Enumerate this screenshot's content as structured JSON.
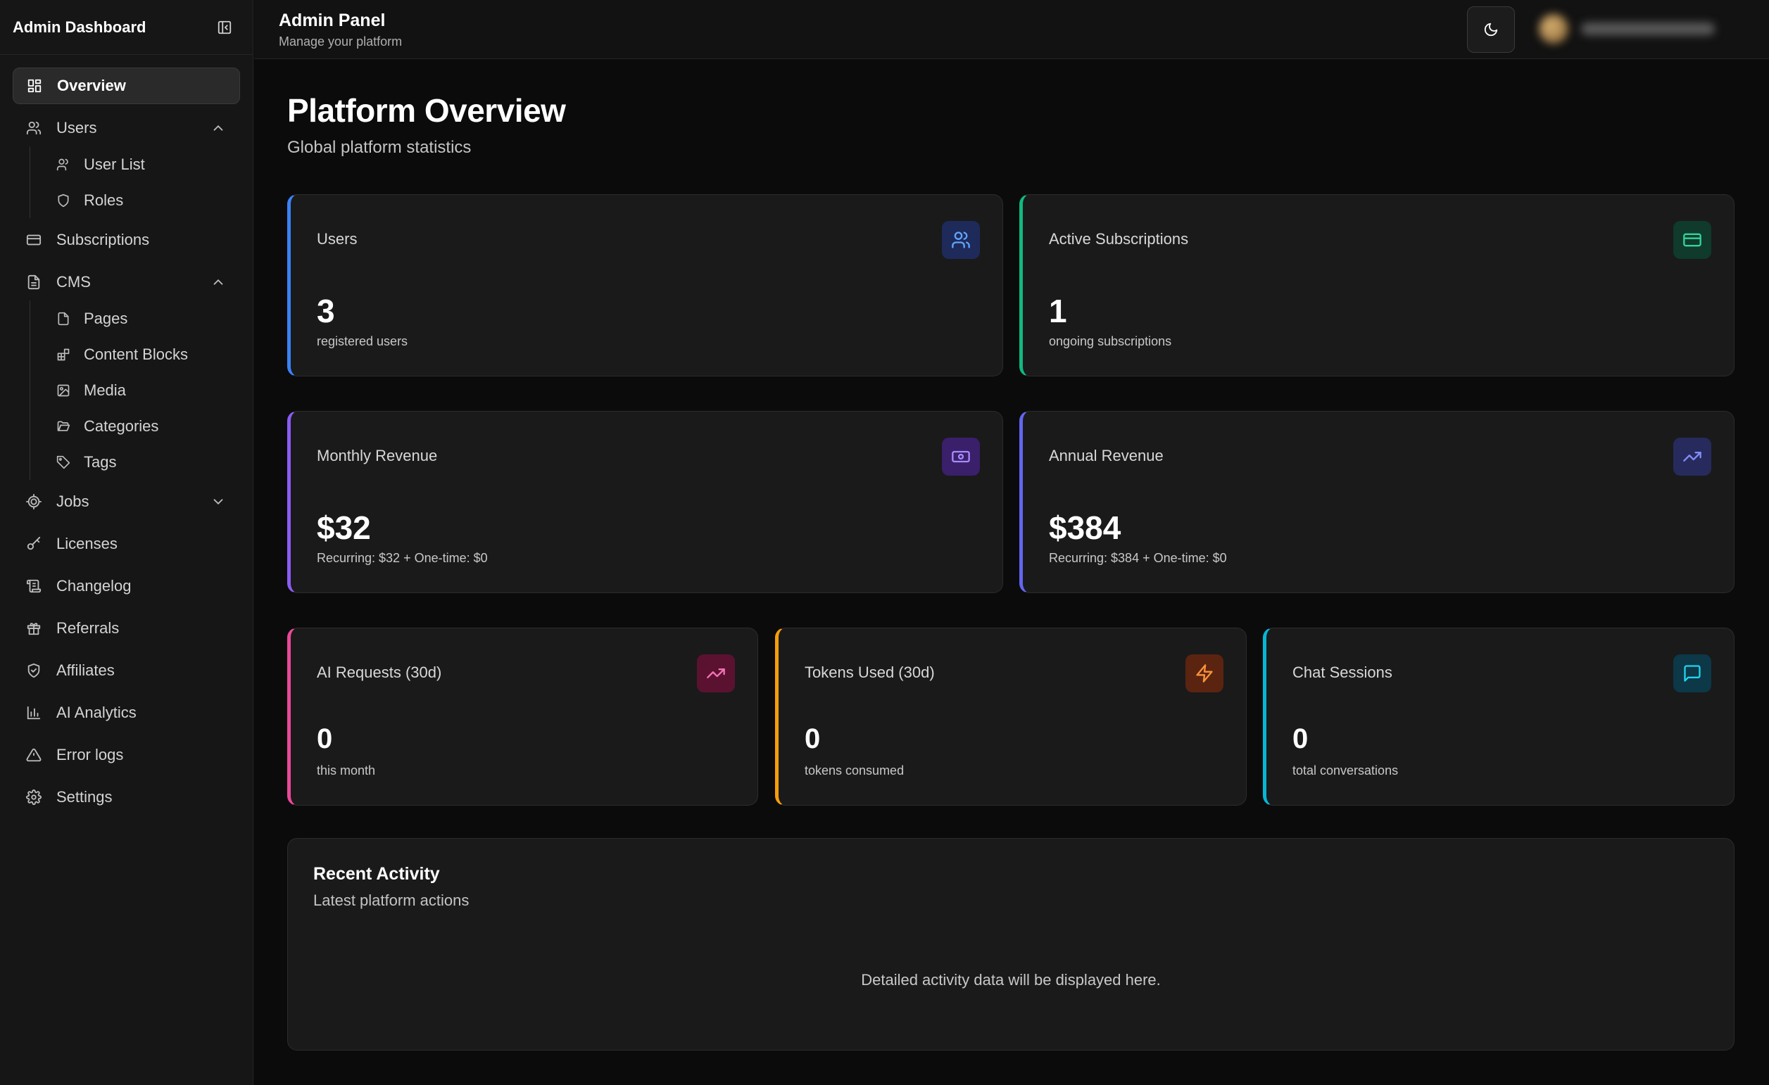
{
  "sidebar": {
    "title": "Admin Dashboard",
    "nav": {
      "overview": "Overview",
      "users": "Users",
      "user_list": "User List",
      "roles": "Roles",
      "subscriptions": "Subscriptions",
      "cms": "CMS",
      "pages": "Pages",
      "content_blocks": "Content Blocks",
      "media": "Media",
      "categories": "Categories",
      "tags": "Tags",
      "jobs": "Jobs",
      "licenses": "Licenses",
      "changelog": "Changelog",
      "referrals": "Referrals",
      "affiliates": "Affiliates",
      "ai_analytics": "AI Analytics",
      "error_logs": "Error logs",
      "settings": "Settings"
    }
  },
  "topbar": {
    "title": "Admin Panel",
    "subtitle": "Manage your platform"
  },
  "main": {
    "title": "Platform Overview",
    "subtitle": "Global platform statistics",
    "cards": {
      "users": {
        "label": "Users",
        "value": "3",
        "note": "registered users",
        "accent": "#3b82f6"
      },
      "subscriptions": {
        "label": "Active Subscriptions",
        "value": "1",
        "note": "ongoing subscriptions",
        "accent": "#10b981"
      },
      "monthly": {
        "label": "Monthly Revenue",
        "value": "$32",
        "note": "Recurring: $32 + One-time: $0",
        "accent": "#8b5cf6"
      },
      "annual": {
        "label": "Annual Revenue",
        "value": "$384",
        "note": "Recurring: $384 + One-time: $0",
        "accent": "#6366f1"
      },
      "ai_requests": {
        "label": "AI Requests (30d)",
        "value": "0",
        "note": "this month",
        "accent": "#ec4899"
      },
      "tokens": {
        "label": "Tokens Used (30d)",
        "value": "0",
        "note": "tokens consumed",
        "accent": "#f59e0b"
      },
      "chat": {
        "label": "Chat Sessions",
        "value": "0",
        "note": "total conversations",
        "accent": "#06b6d4"
      }
    },
    "activity": {
      "title": "Recent Activity",
      "subtitle": "Latest platform actions",
      "empty": "Detailed activity data will be displayed here."
    }
  }
}
